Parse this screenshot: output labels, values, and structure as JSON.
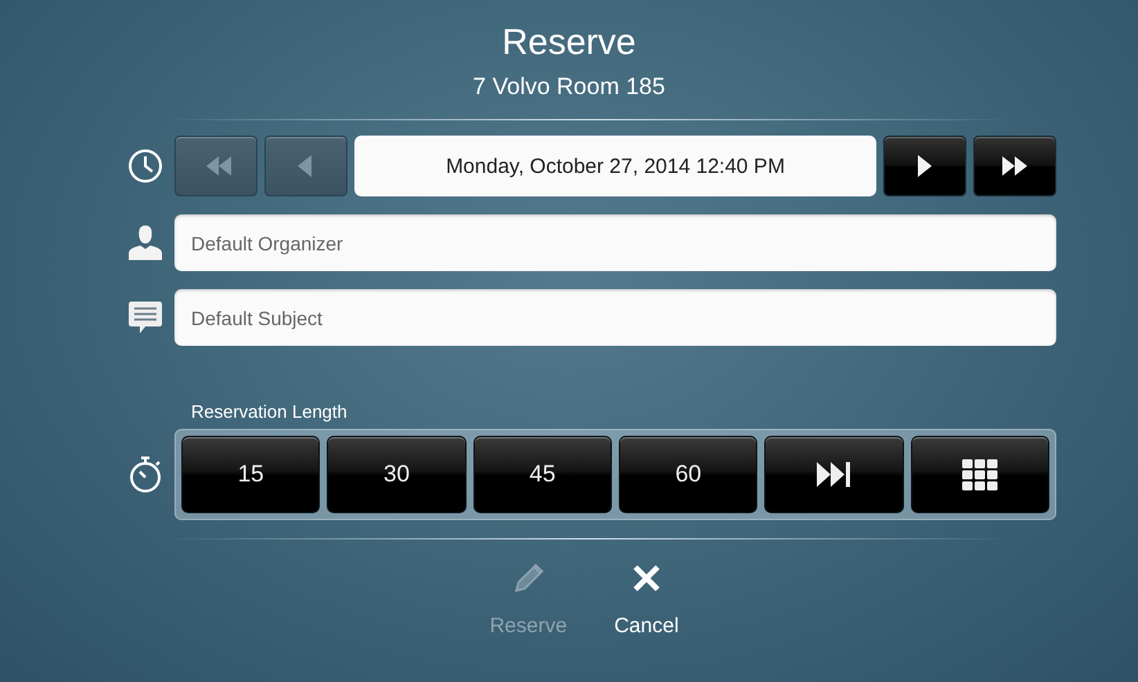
{
  "title": "Reserve",
  "room": "7 Volvo Room 185",
  "date_nav": {
    "value": "Monday, October 27, 2014 12:40 PM",
    "buttons": [
      {
        "kind": "rewind",
        "disabled": true
      },
      {
        "kind": "back",
        "disabled": true
      },
      {
        "kind": "forward",
        "disabled": false
      },
      {
        "kind": "fast-forward",
        "disabled": false
      }
    ]
  },
  "fields": [
    {
      "kind": "organizer",
      "value": "Default Organizer"
    },
    {
      "kind": "subject",
      "value": "Default Subject"
    }
  ],
  "length": {
    "label": "Reservation Length",
    "options": [
      {
        "kind": "number",
        "label": "15"
      },
      {
        "kind": "number",
        "label": "30"
      },
      {
        "kind": "number",
        "label": "45"
      },
      {
        "kind": "number",
        "label": "60"
      },
      {
        "kind": "skip-end"
      },
      {
        "kind": "grid"
      }
    ]
  },
  "actions": [
    {
      "kind": "reserve",
      "label": "Reserve",
      "disabled": true
    },
    {
      "kind": "cancel",
      "label": "Cancel",
      "disabled": false
    }
  ]
}
